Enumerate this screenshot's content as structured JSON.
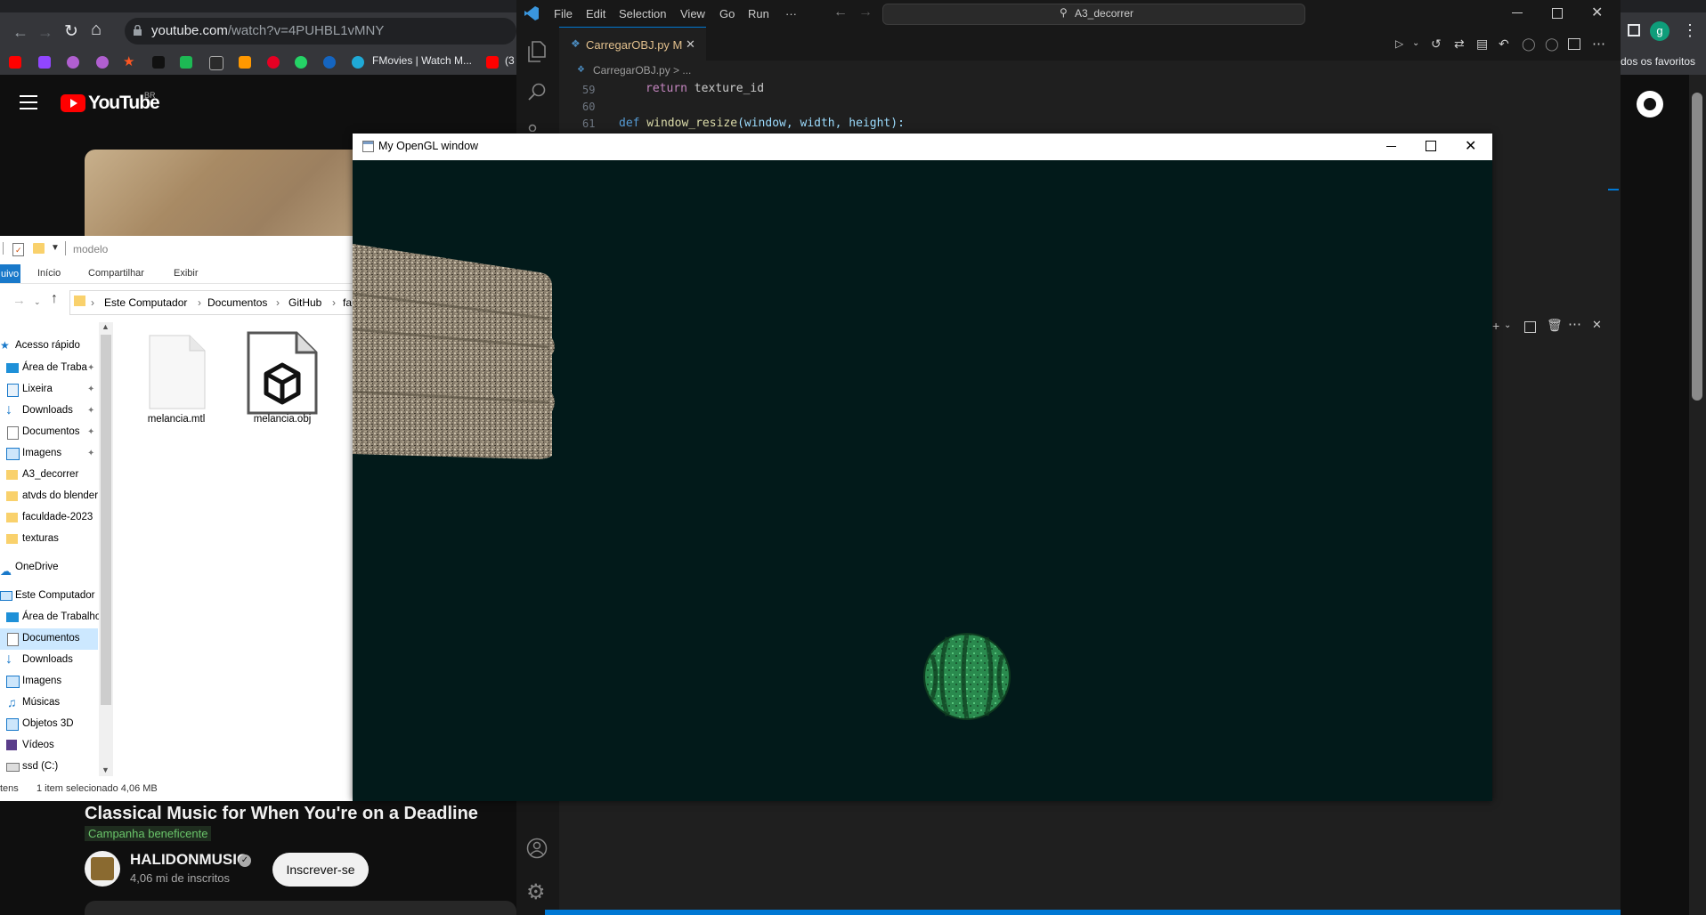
{
  "browser": {
    "url_host": "youtube.com",
    "url_path": "/watch?v=4PUHBL1vMNY",
    "bookmarks": [
      {
        "label": "FMovies | Watch M...",
        "color": "#1fa9d6"
      },
      {
        "label": "(3",
        "color": "#ff0000"
      }
    ],
    "favorites_label": "dos os favoritos",
    "profile_letter": "g"
  },
  "youtube": {
    "logo_text": "YouTube",
    "region": "BR",
    "video_title": "Classical Music for When You're on a Deadline",
    "campaign_badge": "Campanha beneficente",
    "channel_name": "HALIDONMUSIC",
    "subscribers": "4,06 mi de inscritos",
    "subscribe_label": "Inscrever-se"
  },
  "vscode": {
    "menu": [
      "File",
      "Edit",
      "Selection",
      "View",
      "Go",
      "Run",
      "···"
    ],
    "search_text": "A3_decorrer",
    "tab_label": "CarregarOBJ.py",
    "tab_modified": "M",
    "breadcrumb": "CarregarOBJ.py > ...",
    "lines": [
      {
        "num": "59",
        "keyword": "return",
        "text": " texture_id"
      },
      {
        "num": "60",
        "keyword": "",
        "text": ""
      },
      {
        "num": "61",
        "keyword": "def",
        "fn": " window_resize",
        "args": "(window, width, height):"
      }
    ]
  },
  "explorer": {
    "title": "modelo",
    "ribbon_tabs": [
      "uivo",
      "Início",
      "Compartilhar",
      "Exibir"
    ],
    "address": [
      "Este Computador",
      "Documentos",
      "GitHub",
      "fa"
    ],
    "quick_access_label": "Acesso rápido",
    "nav_items": [
      {
        "label": "Área de Traba",
        "pinned": true
      },
      {
        "label": "Lixeira",
        "pinned": true
      },
      {
        "label": "Downloads",
        "pinned": true
      },
      {
        "label": "Documentos",
        "pinned": true
      },
      {
        "label": "Imagens",
        "pinned": true
      },
      {
        "label": "A3_decorrer",
        "pinned": false
      },
      {
        "label": "atvds do blender",
        "pinned": false
      },
      {
        "label": "faculdade-2023",
        "pinned": false
      },
      {
        "label": "texturas",
        "pinned": false
      }
    ],
    "onedrive_label": "OneDrive",
    "this_pc_label": "Este Computador",
    "pc_items": [
      "Área de Trabalho",
      "Documentos",
      "Downloads",
      "Imagens",
      "Músicas",
      "Objetos 3D",
      "Vídeos",
      "ssd (C:)"
    ],
    "selected_pc_item": "Documentos",
    "files": [
      {
        "name": "melancia.mtl",
        "icon": "blank-file-icon"
      },
      {
        "name": "melancia.obj",
        "icon": "3d-object-file-icon"
      }
    ],
    "status_items": "tens",
    "status_selected": "1 item selecionado  4,06 MB"
  },
  "opengl": {
    "title": "My OpenGL window",
    "background": "#021a1a"
  }
}
